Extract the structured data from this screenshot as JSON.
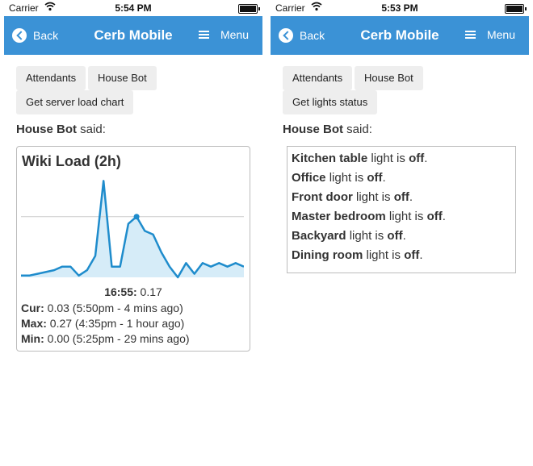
{
  "left": {
    "status": {
      "carrier": "Carrier",
      "time": "5:54 PM"
    },
    "nav": {
      "back": "Back",
      "title": "Cerb Mobile",
      "menu": "Menu"
    },
    "buttons": {
      "attendants": "Attendants",
      "house_bot": "House Bot",
      "action": "Get server load chart"
    },
    "said": {
      "name": "House Bot",
      "text": "said:"
    },
    "chart": {
      "title": "Wiki Load (2h)",
      "readout_time": "16:55:",
      "readout_value": "0.17",
      "cur_label": "Cur:",
      "cur_value": "0.03 (5:50pm - 4 mins ago)",
      "max_label": "Max:",
      "max_value": "0.27 (4:35pm - 1 hour ago)",
      "min_label": "Min:",
      "min_value": "0.00 (5:25pm - 29 mins ago)"
    }
  },
  "right": {
    "status": {
      "carrier": "Carrier",
      "time": "5:53 PM"
    },
    "nav": {
      "back": "Back",
      "title": "Cerb Mobile",
      "menu": "Menu"
    },
    "buttons": {
      "attendants": "Attendants",
      "house_bot": "House Bot",
      "action": "Get lights status"
    },
    "said": {
      "name": "House Bot",
      "text": "said:"
    },
    "lights": [
      {
        "name": "Kitchen table",
        "mid": "light is",
        "state": "off",
        "end": "."
      },
      {
        "name": "Office",
        "mid": "light is",
        "state": "off",
        "end": "."
      },
      {
        "name": "Front door",
        "mid": "light is",
        "state": "off",
        "end": "."
      },
      {
        "name": "Master bedroom",
        "mid": "light is",
        "state": "off",
        "end": "."
      },
      {
        "name": "Backyard",
        "mid": "light is",
        "state": "off",
        "end": "."
      },
      {
        "name": "Dining room",
        "mid": "light is",
        "state": "off",
        "end": "."
      }
    ]
  },
  "colors": {
    "nav": "#3b92d6",
    "series": "#1f8ccc",
    "fill": "#d6ecf8",
    "refline": "#cccccc"
  },
  "chart_data": {
    "type": "area",
    "title": "Wiki Load (2h)",
    "values": [
      0.005,
      0.005,
      0.01,
      0.015,
      0.02,
      0.03,
      0.03,
      0.005,
      0.02,
      0.06,
      0.27,
      0.03,
      0.03,
      0.15,
      0.17,
      0.13,
      0.12,
      0.07,
      0.03,
      0.0,
      0.04,
      0.01,
      0.04,
      0.03,
      0.04,
      0.03,
      0.04,
      0.03
    ],
    "highlight_index": 14,
    "highlight_value": 0.17,
    "reference_line": 0.17,
    "ylim": [
      0,
      0.28
    ],
    "grid": false
  }
}
